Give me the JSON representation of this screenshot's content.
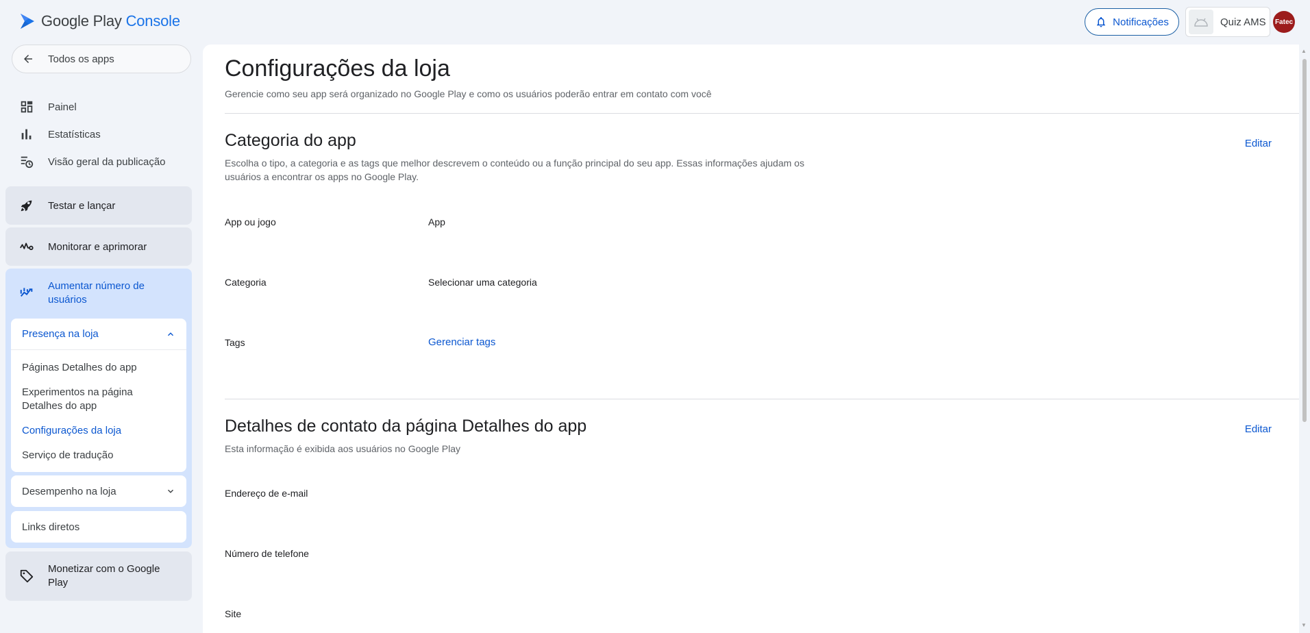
{
  "header": {
    "logo_google_play": "Google Play",
    "logo_console": "Console",
    "notifications_label": "Notificações",
    "app_name": "Quiz AMS",
    "avatar_text": "Fatec"
  },
  "sidebar": {
    "all_apps_label": "Todos os apps",
    "items": [
      {
        "label": "Painel",
        "icon": "dashboard-icon"
      },
      {
        "label": "Estatísticas",
        "icon": "bar-chart-icon"
      },
      {
        "label": "Visão geral da publicação",
        "icon": "publishing-overview-icon"
      }
    ],
    "cards": [
      {
        "label": "Testar e lançar",
        "icon": "rocket-icon"
      },
      {
        "label": "Monitorar e aprimorar",
        "icon": "monitor-pulse-icon"
      },
      {
        "label": "Aumentar número de usuários",
        "icon": "grow-users-icon"
      },
      {
        "label": "Monetizar com o Google Play",
        "icon": "tag-icon"
      }
    ],
    "store_presence": {
      "label": "Presença na loja",
      "items": [
        {
          "label": "Páginas Detalhes do app"
        },
        {
          "label": "Experimentos na página Detalhes do app"
        },
        {
          "label": "Configurações da loja"
        },
        {
          "label": "Serviço de tradução"
        }
      ]
    },
    "store_performance_label": "Desempenho na loja",
    "deep_links_label": "Links diretos"
  },
  "main": {
    "title": "Configurações da loja",
    "subtitle": "Gerencie como seu app será organizado no Google Play e como os usuários poderão entrar em contato com você",
    "category_section": {
      "title": "Categoria do app",
      "description": "Escolha o tipo, a categoria e as tags que melhor descrevem o conteúdo ou a função principal do seu app. Essas informações ajudam os usuários a encontrar os apps no Google Play.",
      "edit_label": "Editar",
      "fields": [
        {
          "label": "App ou jogo",
          "value": "App"
        },
        {
          "label": "Categoria",
          "value": "Selecionar uma categoria"
        },
        {
          "label": "Tags",
          "value": "Gerenciar tags"
        }
      ]
    },
    "contact_section": {
      "title": "Detalhes de contato da página Detalhes do app",
      "description": "Esta informação é exibida aos usuários no Google Play",
      "edit_label": "Editar",
      "fields": [
        {
          "label": "Endereço de e-mail"
        },
        {
          "label": "Número de telefone"
        },
        {
          "label": "Site"
        }
      ]
    }
  },
  "colors": {
    "accent": "#0b57d0",
    "active_card_bg": "#d3e3fd",
    "card_bg": "#e3e7ef",
    "page_bg": "#f1f4f9",
    "avatar_bg": "#9c1c1c"
  }
}
